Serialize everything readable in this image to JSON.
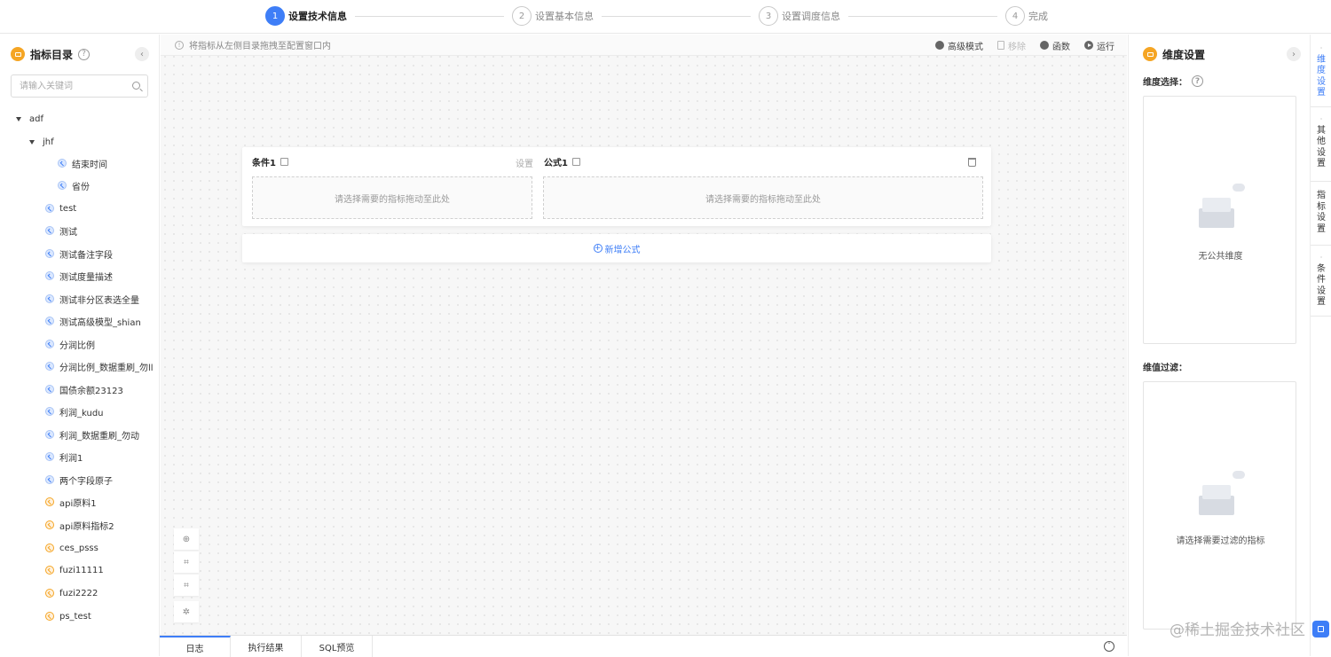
{
  "steps": [
    {
      "num": "1",
      "label": "设置技术信息",
      "active": true
    },
    {
      "num": "2",
      "label": "设置基本信息",
      "active": false
    },
    {
      "num": "3",
      "label": "设置调度信息",
      "active": false
    },
    {
      "num": "4",
      "label": "完成",
      "active": false
    }
  ],
  "sidebar": {
    "title": "指标目录",
    "help_icon": "?",
    "collapse_icon": "‹",
    "search_placeholder": "请输入关键词",
    "tree": [
      {
        "label": "adf",
        "type": "folder"
      },
      {
        "label": "jhf",
        "type": "folder"
      },
      {
        "label": "结束时间",
        "type": "metric"
      },
      {
        "label": "省份",
        "type": "metric"
      },
      {
        "label": "test",
        "type": "metric"
      },
      {
        "label": "测试",
        "type": "metric"
      },
      {
        "label": "测试备注字段",
        "type": "metric"
      },
      {
        "label": "测试度量描述",
        "type": "metric"
      },
      {
        "label": "测试非分区表选全量",
        "type": "metric"
      },
      {
        "label": "测试高级模型_shian",
        "type": "metric"
      },
      {
        "label": "分润比例",
        "type": "metric"
      },
      {
        "label": "分润比例_数据重刷_勿ll",
        "type": "metric"
      },
      {
        "label": "国债余额23123",
        "type": "metric"
      },
      {
        "label": "利润_kudu",
        "type": "metric"
      },
      {
        "label": "利润_数据重刷_勿动",
        "type": "metric"
      },
      {
        "label": "利润1",
        "type": "metric"
      },
      {
        "label": "两个字段原子",
        "type": "metric"
      },
      {
        "label": "api原料1",
        "type": "api"
      },
      {
        "label": "api原料指标2",
        "type": "api"
      },
      {
        "label": "ces_psss",
        "type": "api"
      },
      {
        "label": "fuzi11111",
        "type": "api"
      },
      {
        "label": "fuzi2222",
        "type": "api"
      },
      {
        "label": "ps_test",
        "type": "api"
      }
    ]
  },
  "toolbar": {
    "tip_icon": "!",
    "tip": "将指标从左侧目录拖拽至配置窗口内",
    "advanced_mode": "高级模式",
    "remove": "移除",
    "functions": "函数",
    "run": "运行"
  },
  "card": {
    "condition_title": "条件1",
    "setting_link": "设置",
    "formula_title": "公式1",
    "condition_drop_hint": "请选择需要的指标拖动至此处",
    "formula_drop_hint": "请选择需要的指标拖动至此处"
  },
  "add_formula": {
    "icon": "+",
    "label": "新增公式"
  },
  "zoom_tools": [
    "⊕",
    "⌗",
    "⌗",
    "✲"
  ],
  "bottom_tabs": [
    {
      "label": "日志",
      "active": true
    },
    {
      "label": "执行结果",
      "active": false
    },
    {
      "label": "SQL预览",
      "active": false
    }
  ],
  "bottom_toggle_icon": "ˆ",
  "right_panel": {
    "title": "维度设置",
    "collapse_icon": "›",
    "dimension_select_label": "维度选择：",
    "dimension_empty": "无公共维度",
    "filter_label": "维值过滤：",
    "filter_empty": "请选择需要过滤的指标"
  },
  "side_tabs": [
    {
      "label": "维度设置",
      "active": true
    },
    {
      "label": "其他设置",
      "active": false
    },
    {
      "label": "指标设置",
      "active": false
    },
    {
      "label": "条件设置",
      "active": false
    }
  ],
  "watermark": "@稀土掘金技术社区",
  "colors": {
    "primary": "#3e7ef7",
    "brand": "#f5a524",
    "canvas_bg": "#f7f7f7"
  }
}
